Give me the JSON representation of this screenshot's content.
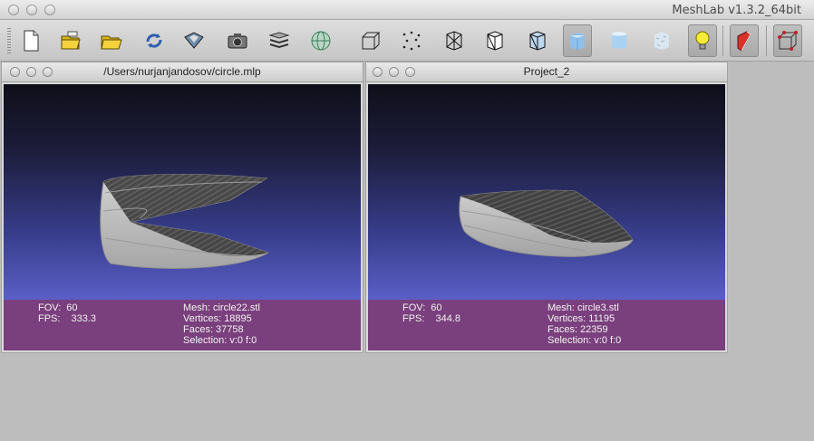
{
  "app": {
    "title": "MeshLab v1.3.2_64bit"
  },
  "toolbar": {
    "buttons": [
      {
        "name": "new-project-icon"
      },
      {
        "name": "open-project-icon"
      },
      {
        "name": "open-mesh-icon"
      },
      {
        "name": "reload-icon"
      },
      {
        "name": "save-icon"
      },
      {
        "name": "snapshot-icon"
      },
      {
        "name": "layers-icon"
      },
      {
        "name": "globe-icon"
      },
      {
        "name": "bounding-box-icon"
      },
      {
        "name": "points-icon"
      },
      {
        "name": "wireframe-icon"
      },
      {
        "name": "hidden-lines-icon"
      },
      {
        "name": "flat-lines-icon"
      },
      {
        "name": "flat-shading-icon"
      },
      {
        "name": "smooth-shading-icon"
      },
      {
        "name": "texture-icon"
      },
      {
        "name": "light-bulb-icon"
      },
      {
        "name": "backface-icon"
      },
      {
        "name": "select-vertices-icon"
      }
    ]
  },
  "windows": [
    {
      "title": "/Users/nurjanjandosov/circle.mlp",
      "fov_label": "FOV:",
      "fov": "60",
      "fps_label": "FPS:",
      "fps": "333.3",
      "mesh_label": "Mesh:",
      "mesh": "circle22.stl",
      "vertices_label": "Vertices:",
      "vertices": "18895",
      "faces_label": "Faces:",
      "faces": "37758",
      "selection_label": "Selection:",
      "selection": "v:0 f:0"
    },
    {
      "title": "Project_2",
      "fov_label": "FOV:",
      "fov": "60",
      "fps_label": "FPS:",
      "fps": "344.8",
      "mesh_label": "Mesh:",
      "mesh": "circle3.stl",
      "vertices_label": "Vertices:",
      "vertices": "11195",
      "faces_label": "Faces:",
      "faces": "22359",
      "selection_label": "Selection:",
      "selection": "v:0 f:0"
    }
  ],
  "colors": {
    "info_bar": "#7a3f7d",
    "mesh_surface": "#b8b8b8",
    "mesh_dark": "#303030"
  }
}
